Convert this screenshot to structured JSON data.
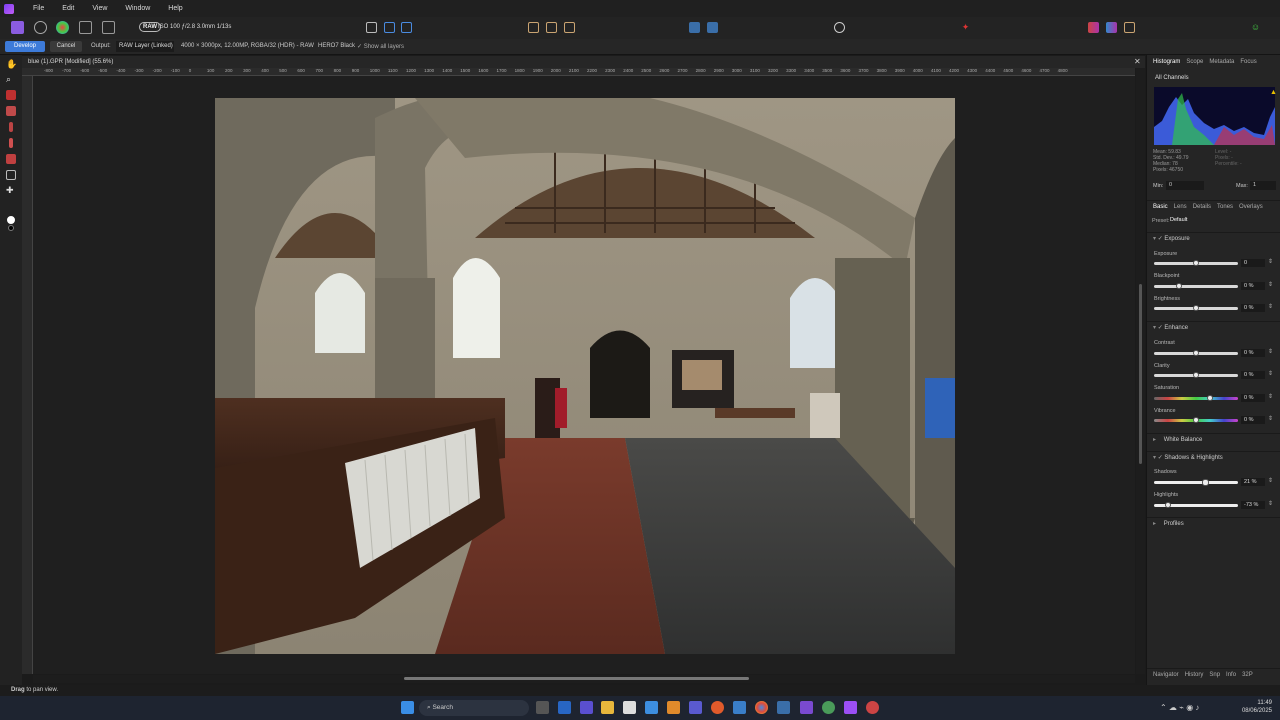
{
  "menubar": {
    "items": [
      "File",
      "Edit",
      "View",
      "Window",
      "Help"
    ]
  },
  "toolbar": {
    "raw_badge": "RAW",
    "camera_info": "ISO 100 ƒ/2.8 3.0mm 1/13s"
  },
  "context": {
    "develop_label": "Develop",
    "cancel_label": "Cancel",
    "output_label": "Output:",
    "output_value": "RAW Layer (Linked)",
    "image_info": "4000 × 3000px, 12.00MP, RGBA/32 (HDR) - RAW",
    "camera_model": "HERO7 Black",
    "show_all_layers": "Show all layers"
  },
  "document": {
    "title": "blue (1).GPR [Modified] (55.6%)"
  },
  "ruler": {
    "ticks": [
      "-800",
      "-700",
      "-600",
      "-500",
      "-400",
      "-300",
      "-200",
      "-100",
      "0",
      "100",
      "200",
      "300",
      "400",
      "500",
      "600",
      "700",
      "800",
      "900",
      "1000",
      "1100",
      "1200",
      "1300",
      "1400",
      "1500",
      "1600",
      "1700",
      "1800",
      "1900",
      "2000",
      "2100",
      "2200",
      "2300",
      "2400",
      "2500",
      "2600",
      "2700",
      "2800",
      "2900",
      "3000",
      "3100",
      "3200",
      "3300",
      "3400",
      "3500",
      "3600",
      "3700",
      "3800",
      "3900",
      "4000",
      "4100",
      "4200",
      "4300",
      "4400",
      "4500",
      "4600",
      "4700",
      "4800"
    ]
  },
  "panel": {
    "top_tabs": [
      "Histogram",
      "Scope",
      "Metadata",
      "Focus"
    ],
    "channels": "All Channels",
    "stats_left": [
      "Mean: 59.83",
      "Std. Dev.: 49.79",
      "Median: 78",
      "Pixels: 46750"
    ],
    "stats_right": [
      "Level: -",
      "Pixels: -",
      "Percentile: -"
    ],
    "min_label": "Min:",
    "min_value": "0",
    "max_label": "Max:",
    "max_value": "1",
    "basic_tabs": [
      "Basic",
      "Lens",
      "Details",
      "Tones",
      "Overlays"
    ],
    "preset_label": "Preset:",
    "preset_value": "Default",
    "sections": {
      "exposure": "Exposure",
      "enhance": "Enhance",
      "white_balance": "White Balance",
      "shadows_highlights": "Shadows & Highlights",
      "profiles": "Profiles"
    },
    "sliders": {
      "exposure": {
        "label": "Exposure",
        "value": "0"
      },
      "blackpoint": {
        "label": "Blackpoint",
        "value": "0 %"
      },
      "brightness": {
        "label": "Brightness",
        "value": "0 %"
      },
      "contrast": {
        "label": "Contrast",
        "value": "0 %"
      },
      "clarity": {
        "label": "Clarity",
        "value": "0 %"
      },
      "saturation": {
        "label": "Saturation",
        "value": "0 %"
      },
      "vibrance": {
        "label": "Vibrance",
        "value": "0 %"
      },
      "shadows": {
        "label": "Shadows",
        "value": "21 %"
      },
      "highlights": {
        "label": "Highlights",
        "value": "-73 %"
      }
    },
    "bottom_tabs": [
      "Navigator",
      "History",
      "Snp",
      "Info",
      "32P"
    ]
  },
  "status": {
    "hint_bold": "Drag",
    "hint_rest": "to pan view."
  },
  "taskbar": {
    "search_placeholder": "Search",
    "time": "11:49",
    "date": "08/06/2025"
  },
  "colors": {
    "accent": "#3d7bd9",
    "brand": "#9b4ff5"
  }
}
